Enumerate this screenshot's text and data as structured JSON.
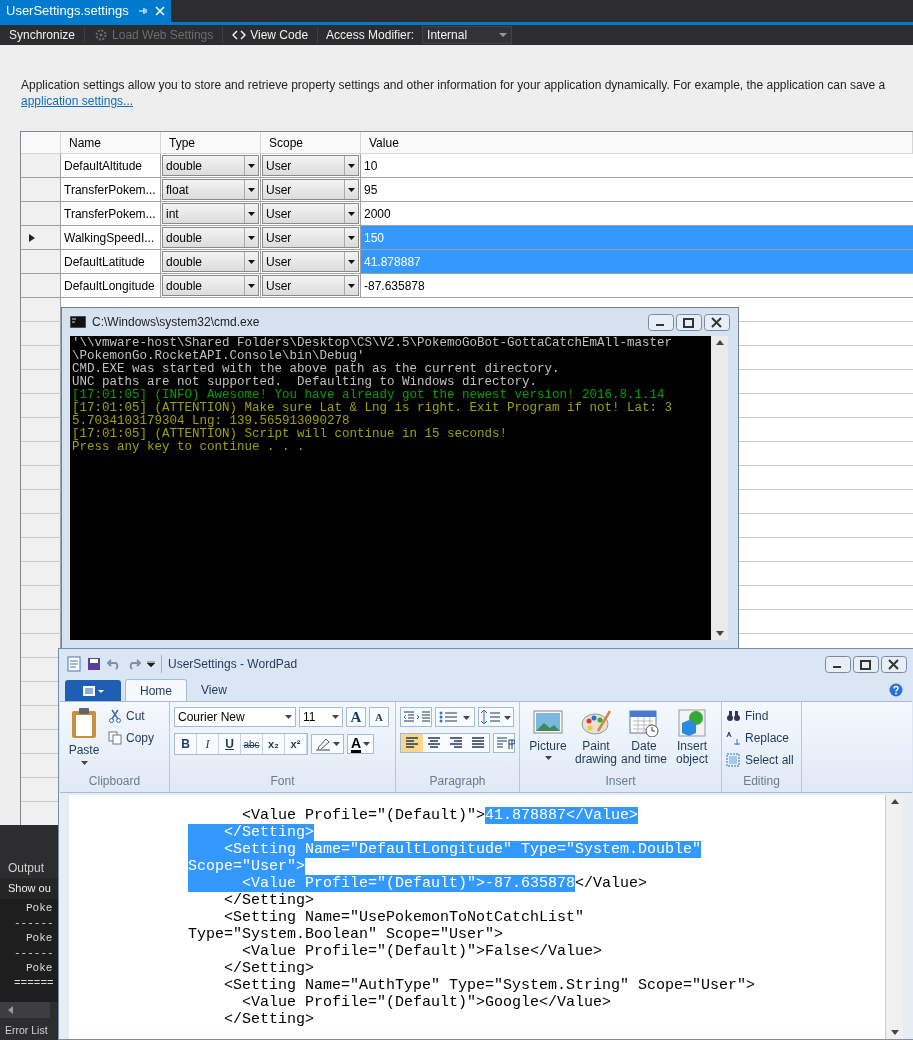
{
  "document_tab": {
    "title": "UserSettings.settings",
    "selected": true
  },
  "toolbar": {
    "buttons": [
      {
        "label": "Synchronize",
        "kind": "plain",
        "disabled": false
      },
      {
        "label": "Load Web Settings",
        "kind": "gear",
        "disabled": true
      },
      {
        "label": "View Code",
        "kind": "code",
        "disabled": false
      }
    ],
    "access_modifier_label": "Access Modifier:",
    "access_modifier_value": "Internal"
  },
  "description": {
    "text": "Application settings allow you to store and retrieve property settings and other information for your application dynamically. For example, the application can save a",
    "link": "application settings..."
  },
  "settings_grid": {
    "columns": [
      "Name",
      "Type",
      "Scope",
      "Value"
    ],
    "rows": [
      {
        "name": "DefaultAltitude",
        "type": "double",
        "scope": "User",
        "value": "10",
        "selected": false,
        "current": false
      },
      {
        "name": "TransferPokem...",
        "type": "float",
        "scope": "User",
        "value": "95",
        "selected": false,
        "current": false
      },
      {
        "name": "TransferPokem...",
        "type": "int",
        "scope": "User",
        "value": "2000",
        "selected": false,
        "current": false
      },
      {
        "name": "WalkingSpeedI...",
        "type": "double",
        "scope": "User",
        "value": "150",
        "selected": true,
        "current": true
      },
      {
        "name": "DefaultLatitude",
        "type": "double",
        "scope": "User",
        "value": "41.878887",
        "selected": true,
        "current": false
      },
      {
        "name": "DefaultLongitude",
        "type": "double",
        "scope": "User",
        "value": "-87.635878",
        "selected": false,
        "current": false
      }
    ]
  },
  "output_panel": {
    "title": "Output",
    "show_output_label": "Show ou",
    "lines": [
      "Poke",
      "------",
      "Poke",
      "------",
      "Poke",
      "======"
    ]
  },
  "error_list_tab": "Error List",
  "cmd_window": {
    "title": "C:\\Windows\\system32\\cmd.exe",
    "lines": [
      {
        "text": "'\\\\vmware-host\\Shared Folders\\Desktop\\CS\\V2.5\\PokemoGoBot-GottaCatchEmAll-master",
        "color": "#c0c0c0"
      },
      {
        "text": "\\PokemonGo.RocketAPI.Console\\bin\\Debug'",
        "color": "#c0c0c0"
      },
      {
        "text": "CMD.EXE was started with the above path as the current directory.",
        "color": "#c0c0c0"
      },
      {
        "text": "UNC paths are not supported.  Defaulting to Windows directory.",
        "color": "#c0c0c0"
      },
      {
        "text": "[17:01:05] (INFO) Awesome! You have already got the newest version! 2016.8.1.14",
        "color": "#00a000"
      },
      {
        "text": "[17:01:05] (ATTENTION) Make sure Lat & Lng is right. Exit Program if not! Lat: 3",
        "color": "#a0a000"
      },
      {
        "text": "5.7034103179304 Lng: 139.565913090278",
        "color": "#a0a000"
      },
      {
        "text": "[17:01:05] (ATTENTION) Script will continue in 15 seconds!",
        "color": "#a0a000"
      },
      {
        "text": "Press any key to continue . . .",
        "color": "#a0a000"
      }
    ]
  },
  "wordpad": {
    "title": "UserSettings - WordPad",
    "tabs": [
      {
        "label": "Home",
        "selected": true
      },
      {
        "label": "View",
        "selected": false
      }
    ],
    "clipboard": {
      "paste": "Paste",
      "cut": "Cut",
      "copy": "Copy",
      "label": "Clipboard"
    },
    "font": {
      "name": "Courier New",
      "size": "11",
      "grow": "A",
      "shrink": "A",
      "styles": [
        "B",
        "I",
        "U",
        "abc",
        "x₂",
        "x²"
      ],
      "color_glyph": "A",
      "label": "Font"
    },
    "paragraph": {
      "label": "Paragraph",
      "alignments": [
        {
          "kind": "left",
          "selected": true
        },
        {
          "kind": "center",
          "selected": false
        },
        {
          "kind": "right",
          "selected": false
        },
        {
          "kind": "justify",
          "selected": false
        }
      ]
    },
    "insert": {
      "label": "Insert",
      "items": [
        {
          "kind": "picture",
          "label": "Picture"
        },
        {
          "kind": "paint",
          "label": "Paint drawing"
        },
        {
          "kind": "datetime",
          "label": "Date and time"
        },
        {
          "kind": "object",
          "label": "Insert object"
        }
      ]
    },
    "editing": {
      "label": "Editing",
      "items": [
        {
          "kind": "find",
          "label": "Find"
        },
        {
          "kind": "replace",
          "label": "Replace"
        },
        {
          "kind": "selectall",
          "label": "Select all"
        }
      ]
    },
    "document_lines": [
      [
        {
          "text": "      <Value Profile=\"(Default)\">",
          "selected": false
        },
        {
          "text": "41.878887</Value>",
          "selected": true
        }
      ],
      [
        {
          "text": "    </Setting>",
          "selected": true
        }
      ],
      [
        {
          "text": "    <Setting Name=\"DefaultLongitude\" Type=\"System.Double\"",
          "selected": true
        }
      ],
      [
        {
          "text": "Scope=\"User\">",
          "selected": true
        }
      ],
      [
        {
          "text": "      <Value Profile=\"(Default)\">-87.635878",
          "selected": true
        },
        {
          "text": "</Value>",
          "selected": false
        }
      ],
      [
        {
          "text": "    </Setting>",
          "selected": false
        }
      ],
      [
        {
          "text": "    <Setting Name=\"UsePokemonToNotCatchList\"",
          "selected": false
        }
      ],
      [
        {
          "text": "Type=\"System.Boolean\" Scope=\"User\">",
          "selected": false
        }
      ],
      [
        {
          "text": "      <Value Profile=\"(Default)\">False</Value>",
          "selected": false
        }
      ],
      [
        {
          "text": "    </Setting>",
          "selected": false
        }
      ],
      [
        {
          "text": "    <Setting Name=\"AuthType\" Type=\"System.String\" Scope=\"User\">",
          "selected": false
        }
      ],
      [
        {
          "text": "      <Value Profile=\"(Default)\">Google</Value>",
          "selected": false
        }
      ],
      [
        {
          "text": "    </Setting>",
          "selected": false
        }
      ]
    ]
  }
}
